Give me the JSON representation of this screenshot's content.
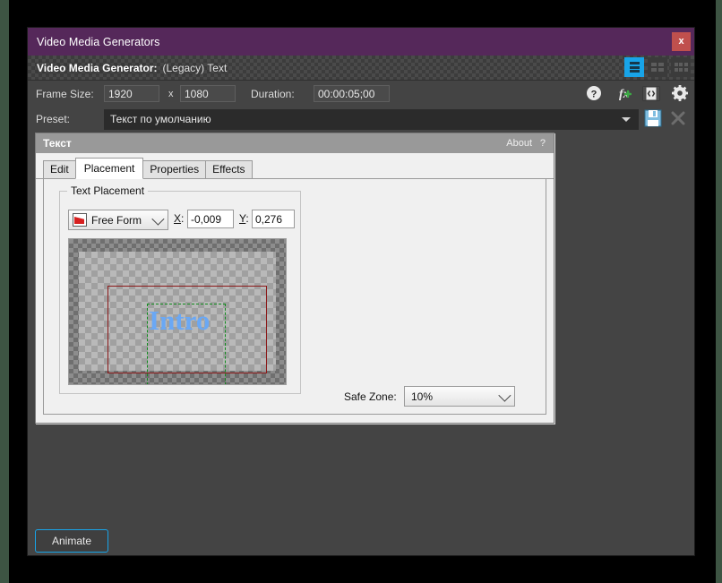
{
  "window": {
    "title": "Video Media Generators",
    "close_label": "x",
    "titlebar_color": "#55285a",
    "close_color": "#c0504d"
  },
  "generator_bar": {
    "label": "Video Media Generator:",
    "value": "(Legacy) Text",
    "view_modes": [
      {
        "name": "list-view",
        "active": true
      },
      {
        "name": "medium-grid-view",
        "active": false
      },
      {
        "name": "small-grid-view",
        "active": false
      }
    ],
    "active_color": "#18a4e8"
  },
  "frame_row": {
    "frame_size_label": "Frame Size:",
    "width_value": "1920",
    "x_separator": "x",
    "height_value": "1080",
    "duration_label": "Duration:",
    "duration_value": "00:00:05;00",
    "icons": [
      "help-icon",
      "plugin-chain-icon",
      "media-window-icon",
      "gear-icon"
    ]
  },
  "preset_row": {
    "label": "Preset:",
    "value": "Текст по умолчанию",
    "save_icon": "save-icon",
    "delete_icon": "delete-icon"
  },
  "plugin_dialog": {
    "title": "Текст",
    "about_label": "About",
    "help_label": "?",
    "tabs": [
      {
        "label": "Edit",
        "active": false
      },
      {
        "label": "Placement",
        "active": true
      },
      {
        "label": "Properties",
        "active": false
      },
      {
        "label": "Effects",
        "active": false
      }
    ]
  },
  "placement": {
    "group_label": "Text Placement",
    "mode_icon": "free-form-icon",
    "mode_value": "Free Form",
    "x_label": "X:",
    "x_value": "-0,009",
    "y_label": "Y:",
    "y_value": "0,276",
    "safe_zone_label": "Safe Zone:",
    "safe_zone_value": "10%",
    "preview": {
      "text": "Intro",
      "text_color": "#6aa8f5",
      "safe_zone_color": "#8c1a1a",
      "selection_color": "#0f8c1c"
    }
  },
  "footer": {
    "animate_label": "Animate",
    "focus_color": "#18a4e8"
  }
}
